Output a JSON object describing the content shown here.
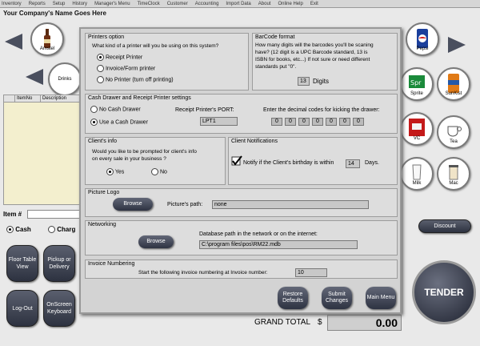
{
  "menu": [
    "Inventory",
    "Reports",
    "Setup",
    "History",
    "Manager's Menu",
    "TimeClock",
    "Customer",
    "Accounting",
    "Import Data",
    "About",
    "Online Help",
    "Exit"
  ],
  "company_name": "Your Company's Name Goes Here",
  "items_top": [
    "Amstel",
    "Pepsi"
  ],
  "drinks_label": "Drinks",
  "right_items": [
    "Sprite",
    "SunKist",
    "VC",
    "Tea",
    "Milk",
    "Mac"
  ],
  "grid_headers": [
    "ItemNo",
    "Description"
  ],
  "item_label": "Item #",
  "payment": {
    "cash": "Cash",
    "charge": "Charg"
  },
  "left_buttons": [
    "Floor Table View",
    "Pickup or Delivery",
    "Log-Out",
    "OnScreen Keyboard"
  ],
  "discount_label": "Discount",
  "tender_label": "TENDER",
  "grand_total_label": "GRAND TOTAL",
  "currency": "$",
  "grand_total_value": "0.00",
  "dialog": {
    "printers": {
      "title": "Printers option",
      "question": "What kind of a  printer will you be using on this system?",
      "options": [
        "Receipt Printer",
        "Invoice/Form printer",
        "No Printer (turn off printing)"
      ],
      "selected": 0
    },
    "barcode": {
      "title": "BarCode format",
      "text1": "How many digits will the barcodes you'll be scaning",
      "text2": "have? (12 digit is a UPC Barcode standard, 13 is",
      "text3": "ISBN for books, etc...)  If not sure or need different",
      "text4": "standards put \"0\".",
      "digits_value": "13",
      "digits_label": "Digits"
    },
    "drawer": {
      "title": "Cash Drawer and Receipt Printer settings",
      "no_drawer": "No Cash Drawer",
      "use_drawer": "Use a Cash Drawer",
      "port_label": "Receipt Printer's PORT:",
      "port_value": "LPT1",
      "codes_label": "Enter the decimal codes for kicking the drawer:",
      "codes": [
        "0",
        "0",
        "0",
        "0",
        "0",
        "0",
        "0"
      ]
    },
    "client_info": {
      "title": "Client's info",
      "question1": "Would you like to be prompted for client's info",
      "question2": "on every sale in your business ?",
      "yes": "Yes",
      "no": "No"
    },
    "notifications": {
      "title": "Client Notifications",
      "text": "Notify if the Client's birthday is within",
      "days_value": "14",
      "days_label": "Days."
    },
    "logo": {
      "title": "Picture Logo",
      "browse": "Browse",
      "path_label": "Picture's path:",
      "path_value": "none"
    },
    "networking": {
      "title": "Networking",
      "browse": "Browse",
      "db_label": "Database path in the network or on the internet:",
      "db_value": "C:\\program files\\pos\\RM22.mdb"
    },
    "invoice": {
      "title": "Invoice Numbering",
      "label": "Start the following  invoice numbering at Invoice number:",
      "value": "10"
    },
    "buttons": [
      "Restore Defaults",
      "Submit Changes",
      "Main Menu"
    ]
  }
}
